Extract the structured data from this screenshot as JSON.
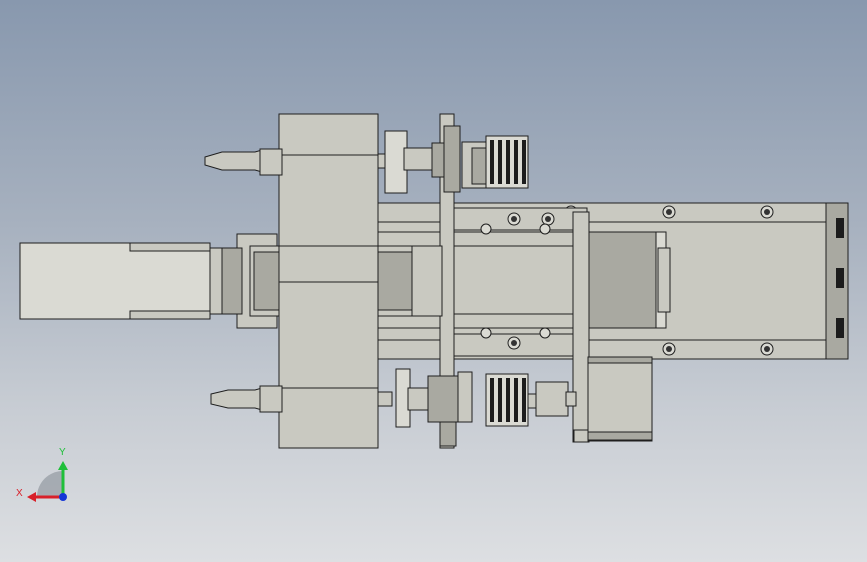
{
  "viewport": {
    "background_top": "#8898ae",
    "background_bottom": "#dddfe2"
  },
  "model": {
    "part_color": "#c9c9c1",
    "edge_color": "#1e1e1e"
  },
  "triad": {
    "x_label": "X",
    "y_label": "Y",
    "x_color": "#d8202a",
    "y_color": "#1fbf3a",
    "z_color": "#1436d6"
  }
}
